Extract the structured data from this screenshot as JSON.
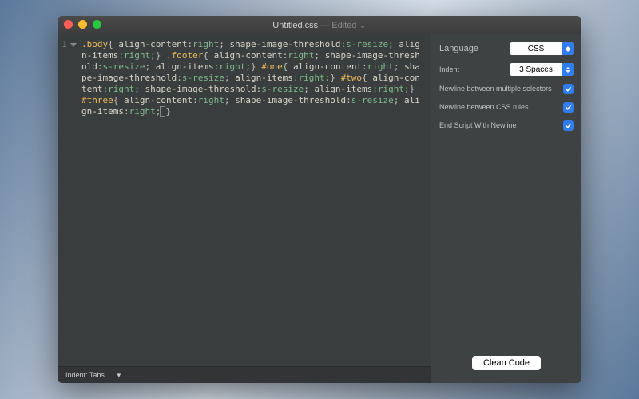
{
  "titlebar": {
    "filename": "Untitled.css",
    "edited_label": " — Edited",
    "dropdown_glyph": "⌄"
  },
  "gutter": {
    "line1": "1"
  },
  "code_tokens": [
    {
      "t": ".body",
      "c": "sel"
    },
    {
      "t": "{ ",
      "c": "punc"
    },
    {
      "t": "align-content",
      "c": "prop"
    },
    {
      "t": ":",
      "c": "punc"
    },
    {
      "t": "right",
      "c": "val"
    },
    {
      "t": "; ",
      "c": "punc"
    },
    {
      "t": "shape-image-threshold",
      "c": "prop"
    },
    {
      "t": ":",
      "c": "punc"
    },
    {
      "t": "s-resize",
      "c": "val"
    },
    {
      "t": "; ",
      "c": "punc"
    },
    {
      "t": "align-items",
      "c": "prop"
    },
    {
      "t": ":",
      "c": "punc"
    },
    {
      "t": "right",
      "c": "val"
    },
    {
      "t": ";} ",
      "c": "punc"
    },
    {
      "t": ".footer",
      "c": "sel"
    },
    {
      "t": "{ ",
      "c": "punc"
    },
    {
      "t": "align-content",
      "c": "prop"
    },
    {
      "t": ":",
      "c": "punc"
    },
    {
      "t": "right",
      "c": "val"
    },
    {
      "t": "; ",
      "c": "punc"
    },
    {
      "t": "shape-image-threshold",
      "c": "prop"
    },
    {
      "t": ":",
      "c": "punc"
    },
    {
      "t": "s-resize",
      "c": "val"
    },
    {
      "t": "; ",
      "c": "punc"
    },
    {
      "t": "align-items",
      "c": "prop"
    },
    {
      "t": ":",
      "c": "punc"
    },
    {
      "t": "right",
      "c": "val"
    },
    {
      "t": ";} ",
      "c": "punc"
    },
    {
      "t": "#one",
      "c": "sel"
    },
    {
      "t": "{ ",
      "c": "punc"
    },
    {
      "t": "align-content",
      "c": "prop"
    },
    {
      "t": ":",
      "c": "punc"
    },
    {
      "t": "right",
      "c": "val"
    },
    {
      "t": "; ",
      "c": "punc"
    },
    {
      "t": "shape-image-threshold",
      "c": "prop"
    },
    {
      "t": ":",
      "c": "punc"
    },
    {
      "t": "s-resize",
      "c": "val"
    },
    {
      "t": "; ",
      "c": "punc"
    },
    {
      "t": "align-items",
      "c": "prop"
    },
    {
      "t": ":",
      "c": "punc"
    },
    {
      "t": "right",
      "c": "val"
    },
    {
      "t": ";} ",
      "c": "punc"
    },
    {
      "t": "#two",
      "c": "sel"
    },
    {
      "t": "{ ",
      "c": "punc"
    },
    {
      "t": "align-content",
      "c": "prop"
    },
    {
      "t": ":",
      "c": "punc"
    },
    {
      "t": "right",
      "c": "val"
    },
    {
      "t": "; ",
      "c": "punc"
    },
    {
      "t": "shape-image-threshold",
      "c": "prop"
    },
    {
      "t": ":",
      "c": "punc"
    },
    {
      "t": "s-resize",
      "c": "val"
    },
    {
      "t": "; ",
      "c": "punc"
    },
    {
      "t": "align-items",
      "c": "prop"
    },
    {
      "t": ":",
      "c": "punc"
    },
    {
      "t": "right",
      "c": "val"
    },
    {
      "t": ";} ",
      "c": "punc"
    },
    {
      "t": "#three",
      "c": "sel"
    },
    {
      "t": "{",
      "c": "punc-cursor"
    },
    {
      "t": " ",
      "c": "punc"
    },
    {
      "t": "align-content",
      "c": "prop"
    },
    {
      "t": ":",
      "c": "punc"
    },
    {
      "t": "right",
      "c": "val"
    },
    {
      "t": "; ",
      "c": "punc"
    },
    {
      "t": "shape-image-threshold",
      "c": "prop"
    },
    {
      "t": ":",
      "c": "punc"
    },
    {
      "t": "s-resize",
      "c": "val"
    },
    {
      "t": "; ",
      "c": "punc"
    },
    {
      "t": "align-items",
      "c": "prop"
    },
    {
      "t": ":",
      "c": "punc"
    },
    {
      "t": "right",
      "c": "val"
    },
    {
      "t": ";",
      "c": "punc"
    },
    {
      "t": "}",
      "c": "punc-end"
    }
  ],
  "statusbar": {
    "indent_label": "Indent: Tabs",
    "arrow": "▼"
  },
  "sidebar": {
    "language_label": "Language",
    "language_value": "CSS",
    "indent_label": "Indent",
    "indent_value": "3 Spaces",
    "opt1_label": "Newline between multiple selectors",
    "opt2_label": "Newline between CSS rules",
    "opt3_label": "End Script With Newline",
    "clean_label": "Clean Code"
  }
}
